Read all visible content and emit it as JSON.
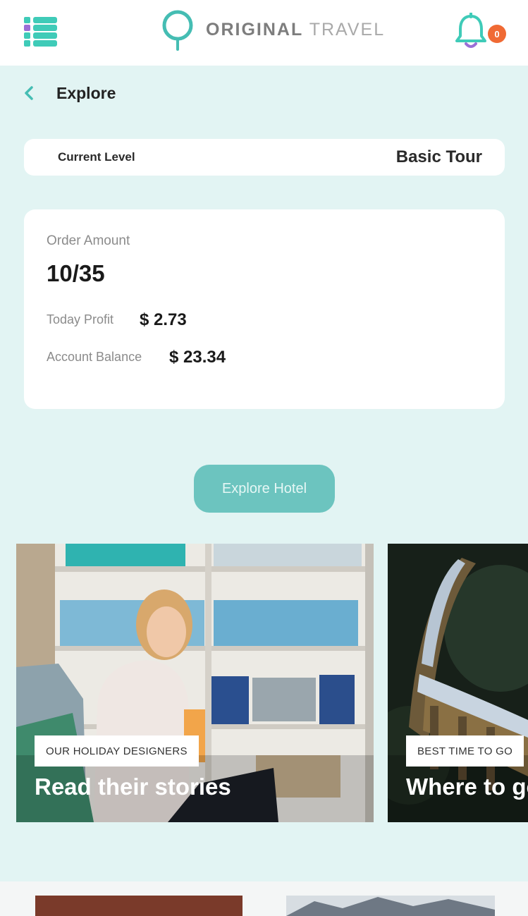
{
  "header": {
    "logo_word_bold": "ORIGINAL",
    "logo_word_light": "TRAVEL",
    "notification_count": "0",
    "menu_icon": "menu-grid-icon",
    "bell_icon": "bell-icon",
    "brand_color": "#3fbfb4",
    "badge_color": "#f06a34"
  },
  "nav": {
    "back_icon": "chevron-left-icon",
    "title": "Explore"
  },
  "level": {
    "label": "Current Level",
    "value": "Basic Tour"
  },
  "stats": {
    "order_label": "Order Amount",
    "order_value": "10/35",
    "profit_label": "Today Profit",
    "profit_value": "$ 2.73",
    "balance_label": "Account Balance",
    "balance_value": "$ 23.34"
  },
  "action": {
    "explore_label": "Explore Hotel",
    "button_color": "#6cc4bf"
  },
  "stories": [
    {
      "tag": "OUR HOLIDAY DESIGNERS",
      "title": "Read their stories"
    },
    {
      "tag": "BEST TIME TO GO",
      "title": "Where to go"
    }
  ]
}
